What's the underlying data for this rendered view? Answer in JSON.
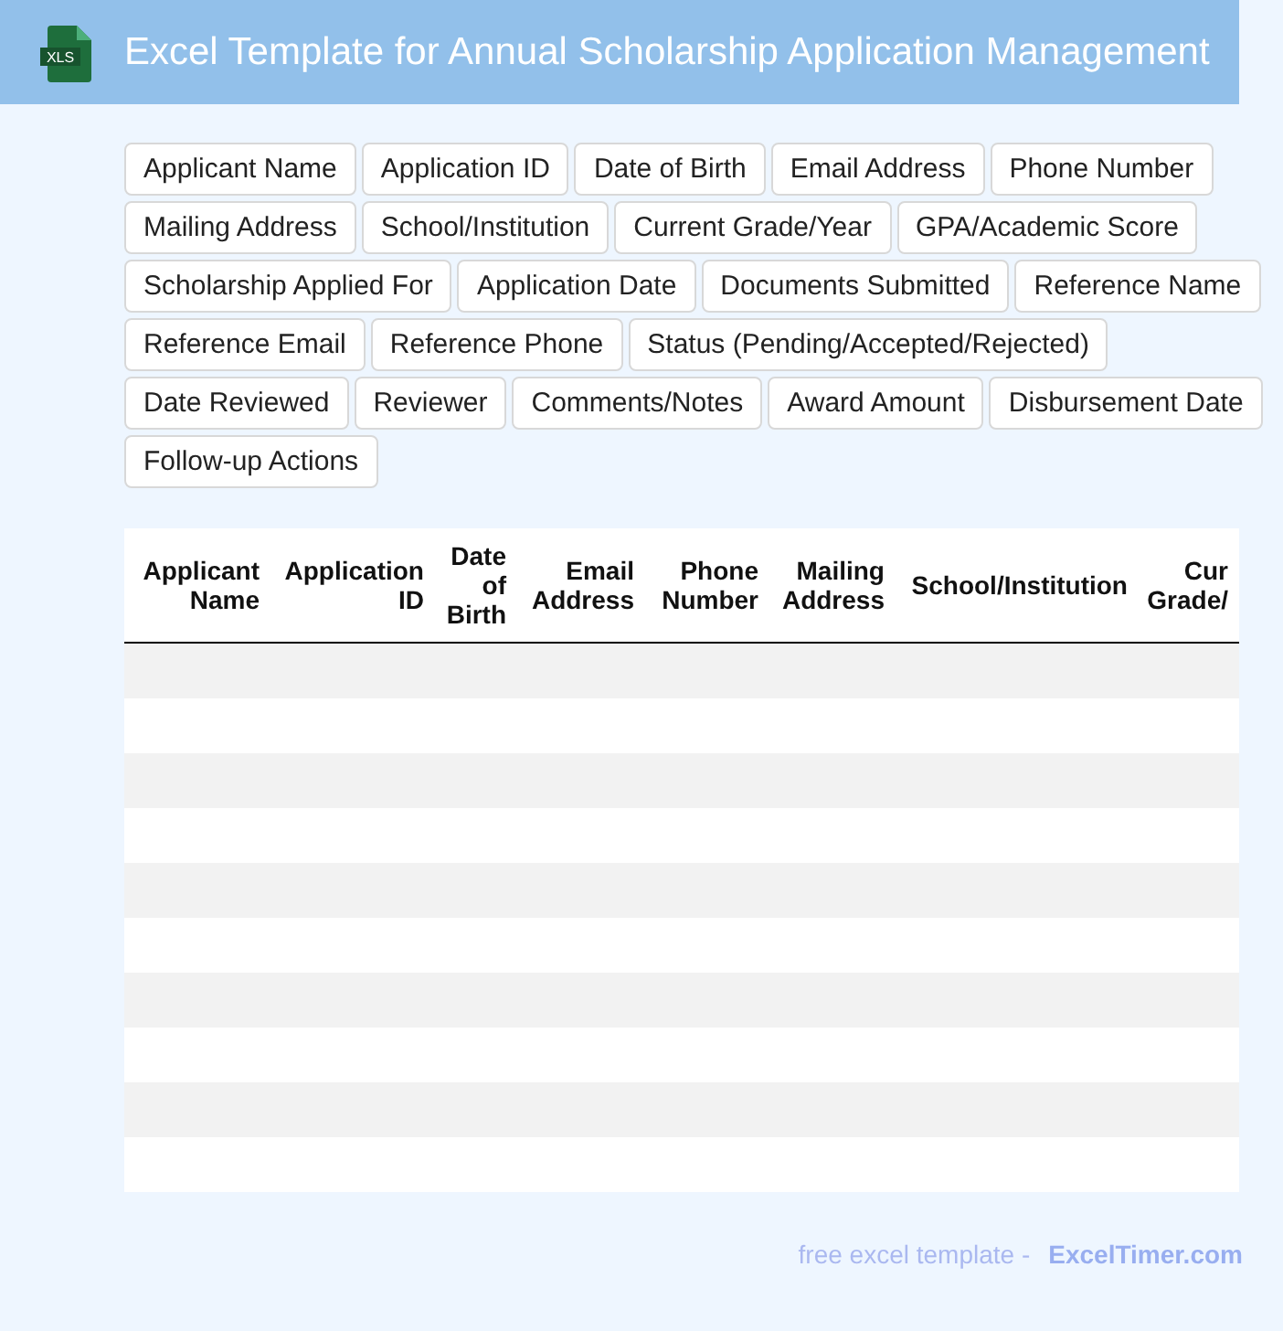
{
  "header": {
    "icon_label": "XLS",
    "title": "Excel Template for Annual Scholarship Application Management"
  },
  "fields": [
    "Applicant Name",
    "Application ID",
    "Date of Birth",
    "Email Address",
    "Phone Number",
    "Mailing Address",
    "School/Institution",
    "Current Grade/Year",
    "GPA/Academic Score",
    "Scholarship Applied For",
    "Application Date",
    "Documents Submitted",
    "Reference Name",
    "Reference Email",
    "Reference Phone",
    "Status (Pending/Accepted/Rejected)",
    "Date Reviewed",
    "Reviewer",
    "Comments/Notes",
    "Award Amount",
    "Disbursement Date",
    "Follow-up Actions"
  ],
  "table": {
    "columns": [
      "Applicant Name",
      "Application ID",
      "Date of Birth",
      "Email Address",
      "Phone Number",
      "Mailing Address",
      "School/Institution",
      "Cur Grade/"
    ]
  },
  "footer": {
    "text": "free excel template -",
    "link": "ExcelTimer.com"
  }
}
